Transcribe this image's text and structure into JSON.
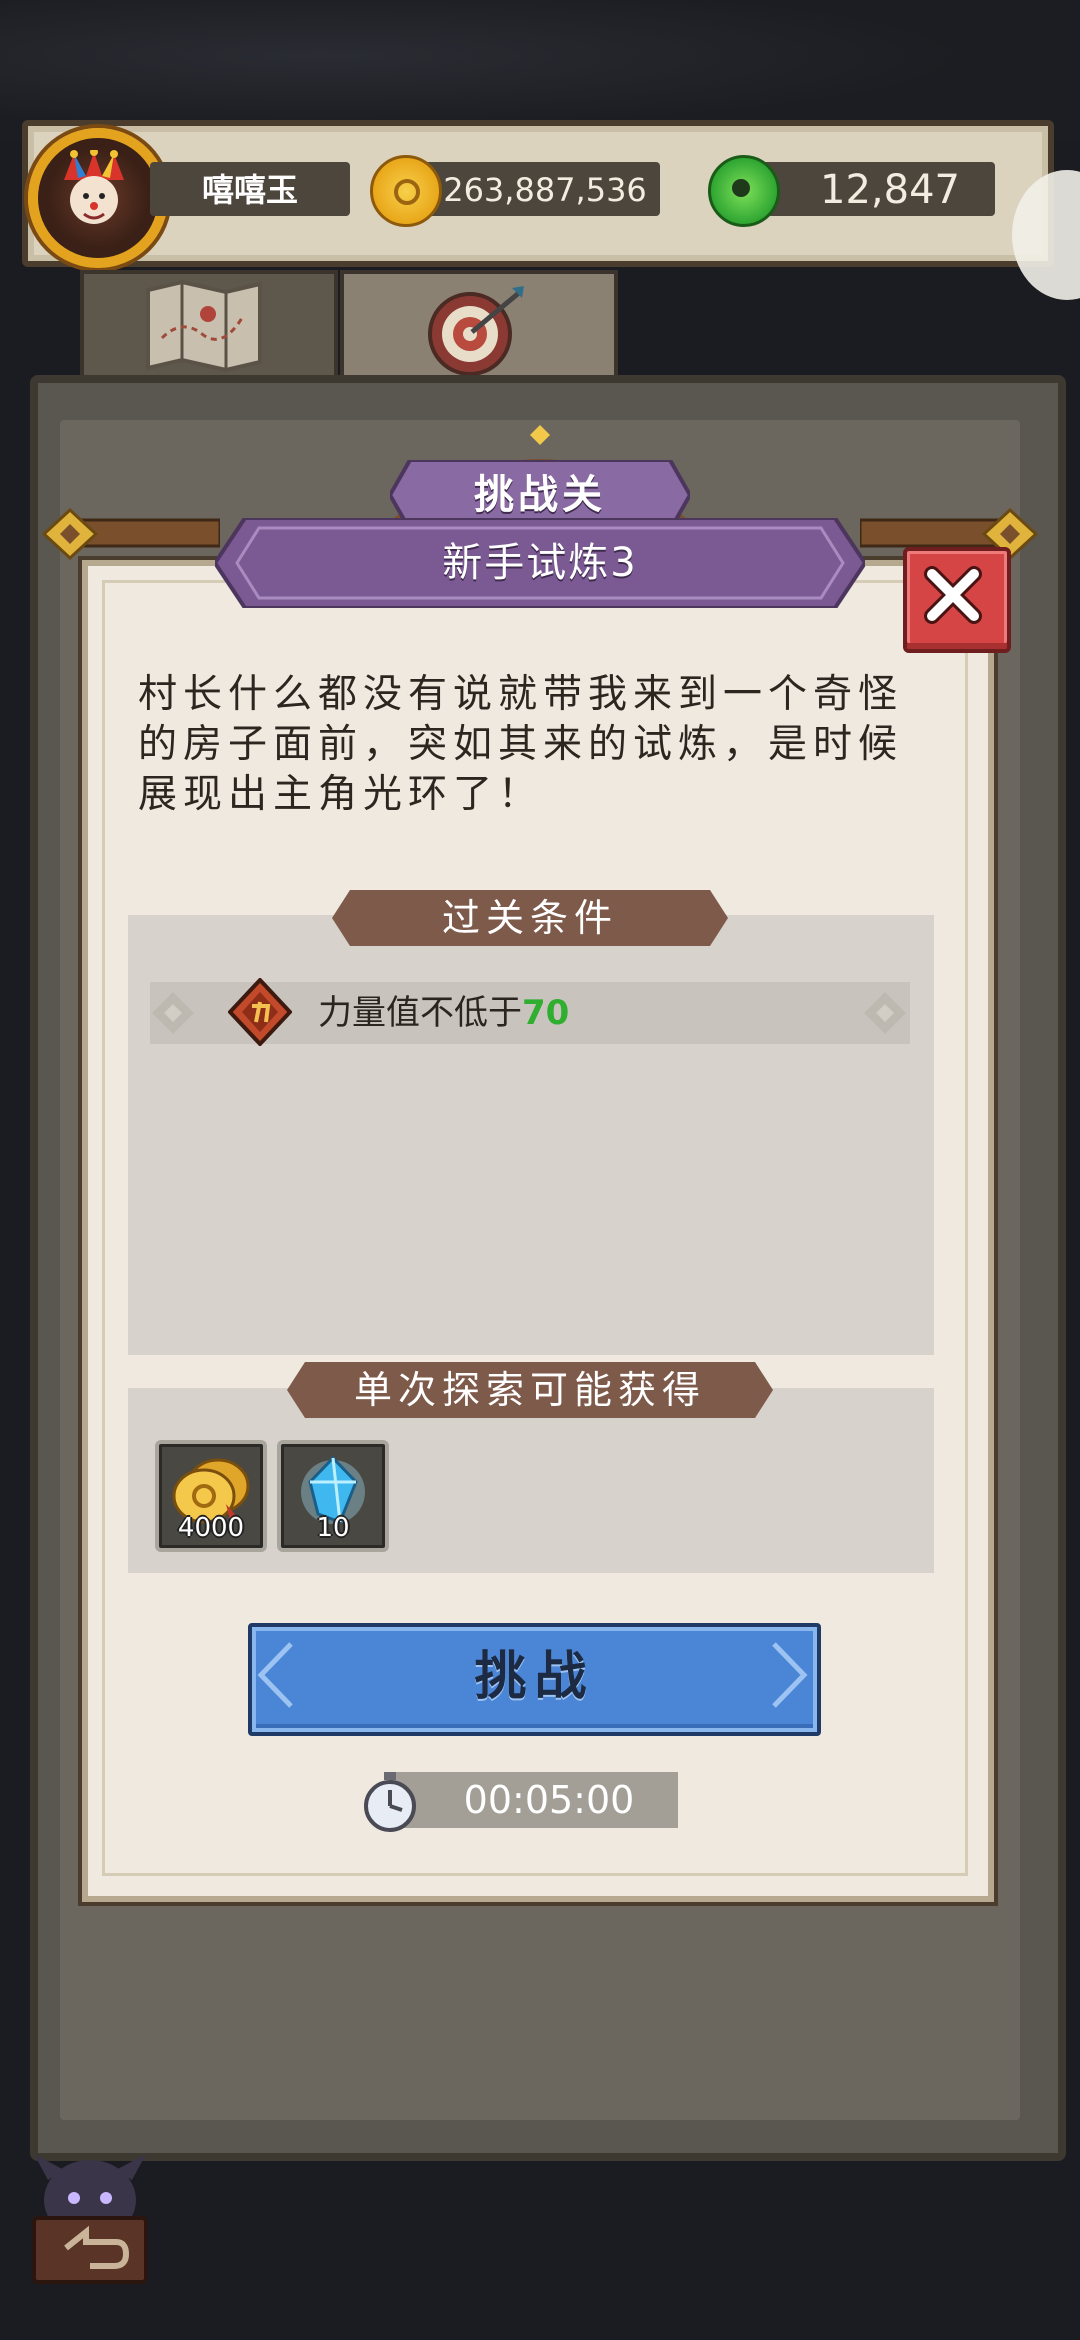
{
  "player": {
    "name": "嘻嘻玉"
  },
  "resources": {
    "coins": "263,887,536",
    "jade": "12,847"
  },
  "tabs": [
    {
      "id": "map",
      "icon": "map-icon"
    },
    {
      "id": "challenge",
      "icon": "target-icon"
    }
  ],
  "dialog": {
    "level_type": "挑战关",
    "level_name": "新手试炼3",
    "story": "村长什么都没有说就带我来到一个奇怪的房子面前，突如其来的试炼，是时候展现出主角光环了！",
    "conditions_title": "过关条件",
    "conditions": [
      {
        "icon": "power-icon",
        "text": "力量值不低于",
        "value": "70"
      }
    ],
    "rewards_title": "单次探索可能获得",
    "rewards": [
      {
        "icon": "gold-coins-icon",
        "count": "4000"
      },
      {
        "icon": "blue-crystal-icon",
        "count": "10"
      }
    ],
    "challenge_label": "挑战",
    "timer": "00:05:00"
  },
  "colors": {
    "accent_blue": "#4b86d6",
    "banner_purple": "#7b5a93",
    "ribbon_brown": "#7e5a4a",
    "close_red": "#d64545",
    "condition_green": "#2fae2f"
  }
}
